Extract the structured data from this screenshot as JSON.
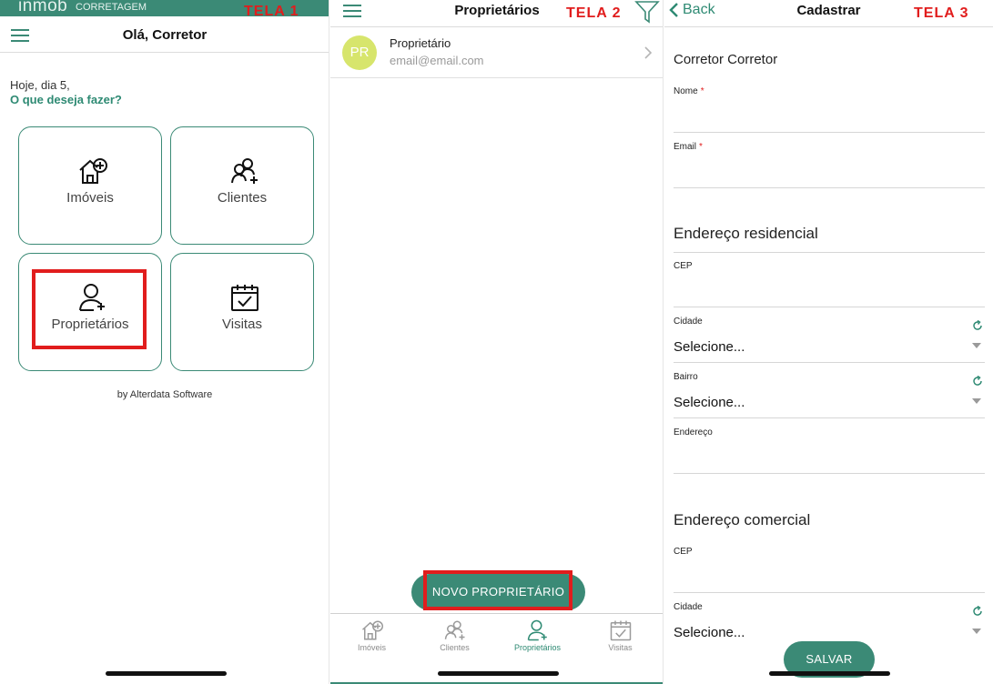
{
  "annotations": {
    "tela1": "TELA 1",
    "tela2": "TELA 2",
    "tela3": "TELA 3"
  },
  "colors": {
    "primary": "#3b8a76",
    "highlight": "#e11d1d",
    "avatar": "#d7e56c"
  },
  "screen1": {
    "logo": "inmob",
    "logo_sub": "CORRETAGEM",
    "title": "Olá, Corretor",
    "greeting": "Hoje, dia 5,",
    "prompt": "O que deseja fazer?",
    "tiles": [
      {
        "label": "Imóveis",
        "icon": "house-plus-icon"
      },
      {
        "label": "Clientes",
        "icon": "users-plus-icon"
      },
      {
        "label": "Proprietários",
        "icon": "user-plus-icon"
      },
      {
        "label": "Visitas",
        "icon": "calendar-check-icon"
      }
    ],
    "footer": "by Alterdata Software"
  },
  "screen2": {
    "title": "Proprietários",
    "list": [
      {
        "initials": "PR",
        "name": "Proprietário",
        "email": "email@email.com"
      }
    ],
    "fab_label": "NOVO PROPRIETÁRIO",
    "tabs": [
      {
        "label": "Imóveis",
        "icon": "house-plus-icon"
      },
      {
        "label": "Clientes",
        "icon": "users-plus-icon"
      },
      {
        "label": "Proprietários",
        "icon": "user-plus-icon",
        "active": true
      },
      {
        "label": "Visitas",
        "icon": "calendar-check-icon"
      }
    ]
  },
  "screen3": {
    "back_label": "Back",
    "title": "Cadastrar",
    "sections": {
      "owner": "Corretor Corretor",
      "residential": "Endereço residencial",
      "commercial": "Endereço comercial"
    },
    "fields": {
      "nome": "Nome",
      "email": "Email",
      "cep": "CEP",
      "cidade": "Cidade",
      "bairro": "Bairro",
      "endereco": "Endereço",
      "cep2": "CEP",
      "cidade2": "Cidade"
    },
    "select_placeholder": "Selecione...",
    "save_label": "SALVAR"
  }
}
